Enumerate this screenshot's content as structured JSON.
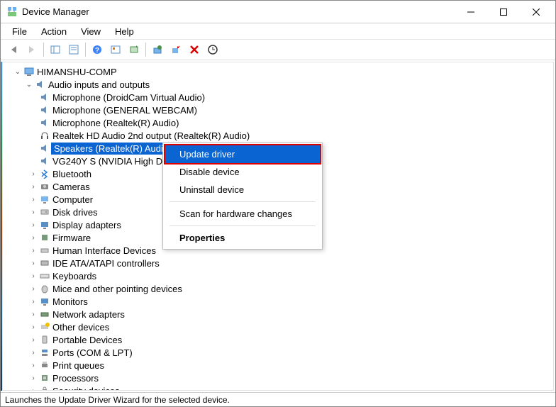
{
  "window": {
    "title": "Device Manager"
  },
  "menubar": {
    "items": [
      "File",
      "Action",
      "View",
      "Help"
    ]
  },
  "tree": {
    "root": "HIMANSHU-COMP",
    "audio_group": "Audio inputs and outputs",
    "audio_devices": [
      "Microphone (DroidCam Virtual Audio)",
      "Microphone (GENERAL WEBCAM)",
      "Microphone (Realtek(R) Audio)",
      "Realtek HD Audio 2nd output (Realtek(R) Audio)",
      "Speakers (Realtek(R) Audio)",
      "VG240Y S (NVIDIA High D"
    ],
    "categories": [
      "Bluetooth",
      "Cameras",
      "Computer",
      "Disk drives",
      "Display adapters",
      "Firmware",
      "Human Interface Devices",
      "IDE ATA/ATAPI controllers",
      "Keyboards",
      "Mice and other pointing devices",
      "Monitors",
      "Network adapters",
      "Other devices",
      "Portable Devices",
      "Ports (COM & LPT)",
      "Print queues",
      "Processors",
      "Security devices"
    ]
  },
  "context_menu": {
    "items": [
      "Update driver",
      "Disable device",
      "Uninstall device",
      "Scan for hardware changes",
      "Properties"
    ]
  },
  "statusbar": {
    "text": "Launches the Update Driver Wizard for the selected device."
  }
}
